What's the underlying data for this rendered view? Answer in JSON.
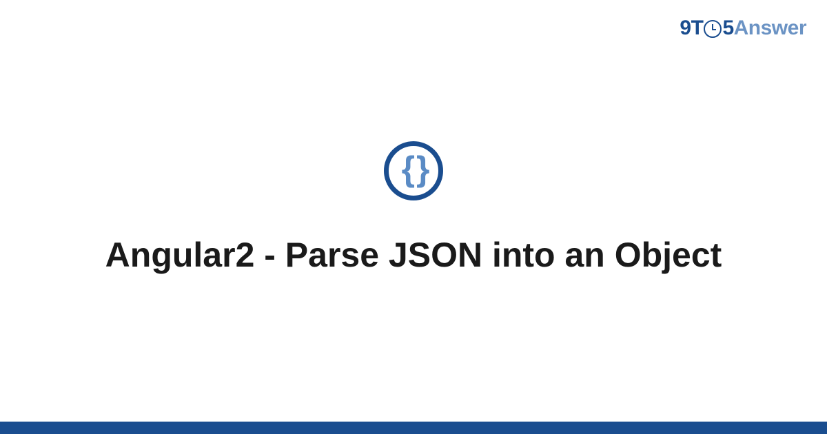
{
  "logo": {
    "nine": "9",
    "t": "T",
    "five": "5",
    "answer": "Answer"
  },
  "icon": {
    "braces": "{ }"
  },
  "title": "Angular2 - Parse JSON into an Object",
  "colors": {
    "primary": "#1a4d8f",
    "secondary": "#6b93c4",
    "icon_braces": "#5a8bc5"
  }
}
